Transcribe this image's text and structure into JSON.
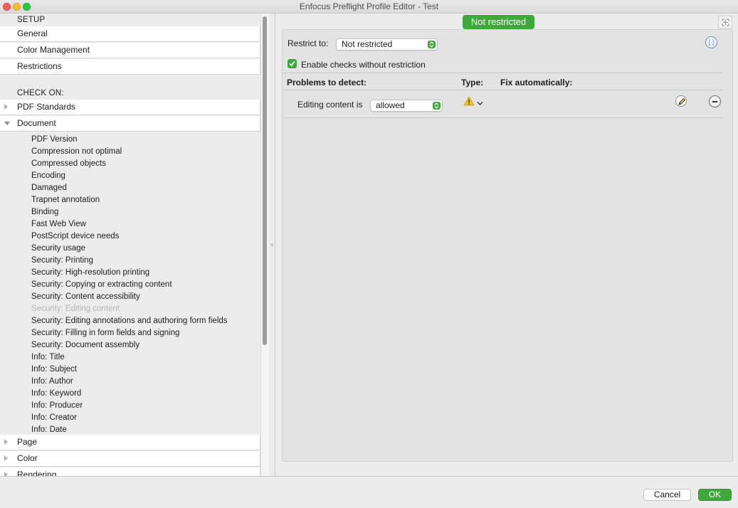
{
  "window": {
    "title": "Enfocus Preflight Profile Editor - Test"
  },
  "sidebar": {
    "setup_heading": "SETUP",
    "setup_items": [
      {
        "label": "General"
      },
      {
        "label": "Color Management"
      },
      {
        "label": "Restrictions"
      }
    ],
    "check_on_heading": "CHECK ON:",
    "groups": [
      {
        "label": "PDF Standards",
        "expanded": false
      },
      {
        "label": "Document",
        "expanded": true
      },
      {
        "label": "Page",
        "expanded": false
      },
      {
        "label": "Color",
        "expanded": false
      },
      {
        "label": "Rendering",
        "expanded": false
      }
    ],
    "document_items": [
      {
        "label": "PDF Version"
      },
      {
        "label": "Compression not optimal"
      },
      {
        "label": "Compressed objects"
      },
      {
        "label": "Encoding"
      },
      {
        "label": "Damaged"
      },
      {
        "label": "Trapnet annotation"
      },
      {
        "label": "Binding"
      },
      {
        "label": "Fast Web View"
      },
      {
        "label": "PostScript device needs"
      },
      {
        "label": "Security usage"
      },
      {
        "label": "Security: Printing"
      },
      {
        "label": "Security: High-resolution printing"
      },
      {
        "label": "Security: Copying or extracting content"
      },
      {
        "label": "Security: Content accessibility"
      },
      {
        "label": "Security: Editing content",
        "selected": true
      },
      {
        "label": "Security: Editing annotations and authoring form fields"
      },
      {
        "label": "Security: Filling in form fields and signing"
      },
      {
        "label": "Security: Document assembly"
      },
      {
        "label": "Info: Title"
      },
      {
        "label": "Info: Subject"
      },
      {
        "label": "Info: Author"
      },
      {
        "label": "Info: Keyword"
      },
      {
        "label": "Info: Producer"
      },
      {
        "label": "Info: Creator"
      },
      {
        "label": "Info: Date"
      }
    ]
  },
  "editor": {
    "status_badge": "Not restricted",
    "restrict_label": "Restrict to:",
    "restrict_value": "Not restricted",
    "enable_checks_label": "Enable checks without restriction",
    "enable_checks_checked": true,
    "info_icon_text": "[ ]",
    "columns": {
      "problems": "Problems to detect:",
      "type": "Type:",
      "fix": "Fix automatically:"
    },
    "rule": {
      "label": "Editing content is",
      "value": "allowed",
      "type_icon": "warning-icon"
    }
  },
  "footer": {
    "cancel_label": "Cancel",
    "ok_label": "OK"
  },
  "colors": {
    "accent_green": "#3ea93a",
    "warning_yellow": "#f5c518",
    "link_blue": "#6f8fd6"
  }
}
